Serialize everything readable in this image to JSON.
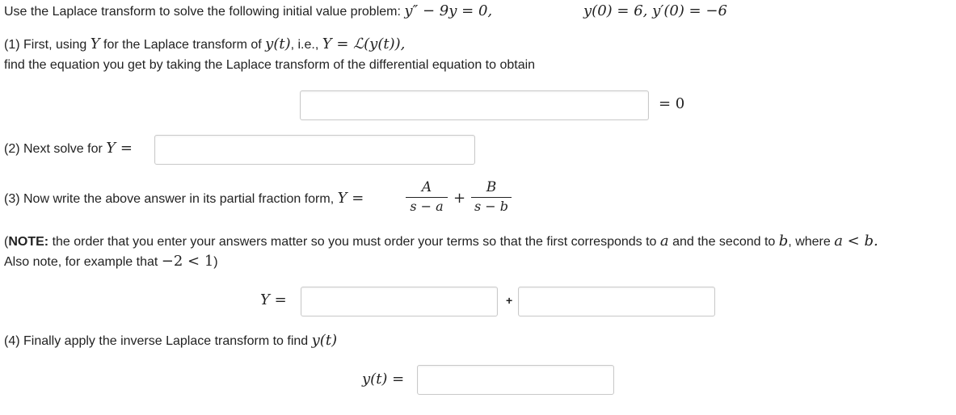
{
  "problem": {
    "intro": "Use the Laplace transform to solve the following initial value problem:",
    "ode": "y″ − 9y = 0,",
    "initial_conditions": "y(0) = 6,  y′(0) = −6"
  },
  "part1": {
    "line1_prefix": "(1) First, using",
    "line1_Y": "Y",
    "line1_mid": "for the Laplace transform of",
    "line1_yt": "y(t)",
    "line1_ie": ", i.e.,",
    "line1_def": "Y = ℒ(y(t)),",
    "line2": "find the equation you get by taking the Laplace transform of the differential equation to obtain",
    "equals_zero": "= 0"
  },
  "part2": {
    "label": "(2) Next solve for",
    "Y_eq": "Y ="
  },
  "part3": {
    "label": "(3) Now write the above answer in its partial fraction form,",
    "Y_eq": "Y =",
    "frac1_num": "A",
    "frac1_den": "s − a",
    "plus": "+",
    "frac2_num": "B",
    "frac2_den": "s − b"
  },
  "note": {
    "paren_open": "(",
    "bold": "NOTE:",
    "text": "the order that you enter your answers matter so you must order your terms so that the first corresponds to",
    "a": "a",
    "and_text": "and the second to",
    "b": "b",
    "where_text": ", where",
    "ineq": "a < b.",
    "line2_text": "Also note, for example that",
    "line2_math": "−2 < 1",
    "line2_close": ")"
  },
  "answer_row": {
    "Y_eq": "Y =",
    "plus": "+"
  },
  "part4": {
    "label": "(4) Finally apply the inverse Laplace transform to find",
    "yt": "y(t)",
    "yt_eq": "y(t) ="
  },
  "inputs": {
    "eq1": "",
    "Y": "",
    "partial_A": "",
    "partial_B": "",
    "yt": ""
  }
}
